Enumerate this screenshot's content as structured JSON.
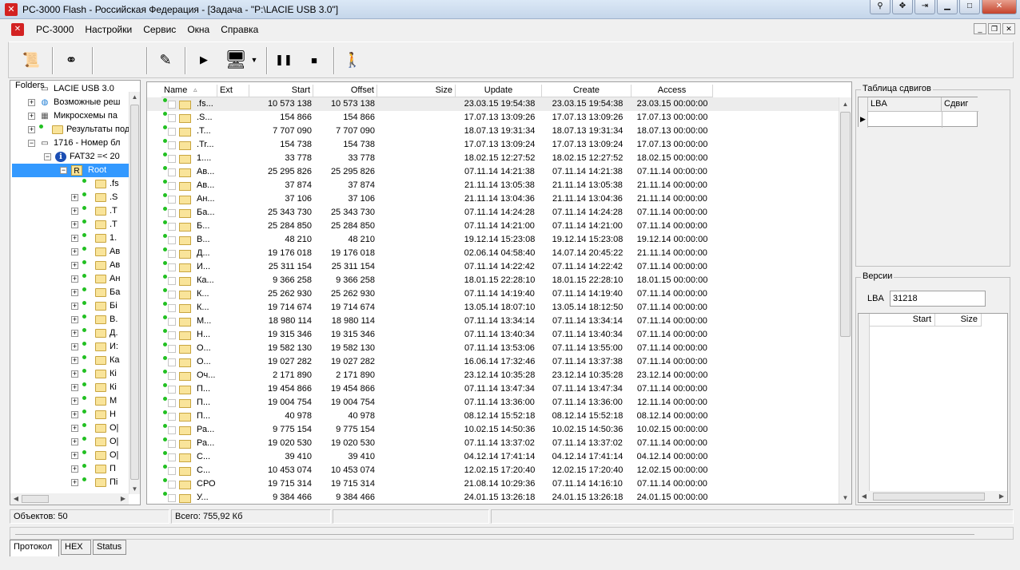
{
  "window": {
    "title": "PC-3000 Flash  - Российская Федерация - [Задача - \"P:\\LACIE USB 3.0\"]",
    "icon_text": "✕"
  },
  "menu": {
    "items": [
      "PC-3000",
      "Настройки",
      "Сервис",
      "Окна",
      "Справка"
    ]
  },
  "left_panel": {
    "title": "Folders",
    "tree": [
      {
        "label": "LACIE USB 3.0",
        "level": 1,
        "expand": "",
        "icon": "drive"
      },
      {
        "label": "Возможные реш",
        "level": 1,
        "expand": "+",
        "icon": "globe"
      },
      {
        "label": "Микросхемы па",
        "level": 1,
        "expand": "+",
        "icon": "chip"
      },
      {
        "label": "Результаты под",
        "level": 1,
        "expand": "+",
        "icon": "folder"
      },
      {
        "label": "1716 - Номер бл",
        "level": 1,
        "expand": "-",
        "icon": "drive"
      },
      {
        "label": "FAT32 =< 20",
        "level": 2,
        "expand": "-",
        "icon": "info"
      },
      {
        "label": "Root",
        "level": 3,
        "expand": "-",
        "icon": "root",
        "selected": true
      },
      {
        "label": ".fs",
        "level": 4,
        "expand": "",
        "icon": "folder"
      },
      {
        "label": ".S",
        "level": 4,
        "expand": "+",
        "icon": "folder"
      },
      {
        "label": ".T",
        "level": 4,
        "expand": "+",
        "icon": "folder"
      },
      {
        "label": ".T",
        "level": 4,
        "expand": "+",
        "icon": "folder"
      },
      {
        "label": "1.",
        "level": 4,
        "expand": "+",
        "icon": "folder"
      },
      {
        "label": "Ав",
        "level": 4,
        "expand": "+",
        "icon": "folder"
      },
      {
        "label": "Ав",
        "level": 4,
        "expand": "+",
        "icon": "folder"
      },
      {
        "label": "Ан",
        "level": 4,
        "expand": "+",
        "icon": "folder"
      },
      {
        "label": "Ба",
        "level": 4,
        "expand": "+",
        "icon": "folder"
      },
      {
        "label": "Бі",
        "level": 4,
        "expand": "+",
        "icon": "folder"
      },
      {
        "label": "В.",
        "level": 4,
        "expand": "+",
        "icon": "folder"
      },
      {
        "label": "Д.",
        "level": 4,
        "expand": "+",
        "icon": "folder"
      },
      {
        "label": "И:",
        "level": 4,
        "expand": "+",
        "icon": "folder"
      },
      {
        "label": "Ка",
        "level": 4,
        "expand": "+",
        "icon": "folder"
      },
      {
        "label": "Кі",
        "level": 4,
        "expand": "+",
        "icon": "folder"
      },
      {
        "label": "Кі",
        "level": 4,
        "expand": "+",
        "icon": "folder"
      },
      {
        "label": "М",
        "level": 4,
        "expand": "+",
        "icon": "folder"
      },
      {
        "label": "Н",
        "level": 4,
        "expand": "+",
        "icon": "folder"
      },
      {
        "label": "О|",
        "level": 4,
        "expand": "+",
        "icon": "folder"
      },
      {
        "label": "О|",
        "level": 4,
        "expand": "+",
        "icon": "folder"
      },
      {
        "label": "О|",
        "level": 4,
        "expand": "+",
        "icon": "folder"
      },
      {
        "label": "П",
        "level": 4,
        "expand": "+",
        "icon": "folder"
      },
      {
        "label": "Пі",
        "level": 4,
        "expand": "+",
        "icon": "folder"
      }
    ]
  },
  "grid": {
    "columns": [
      "Name",
      "Ext",
      "Start",
      "Offset",
      "Size",
      "Update",
      "Create",
      "Access"
    ],
    "rows": [
      [
        ".fs...",
        "",
        "10 573 138",
        "10 573 138",
        "",
        "23.03.15 19:54:38",
        "23.03.15 19:54:38",
        "23.03.15 00:00:00"
      ],
      [
        ".S...",
        "",
        "154 866",
        "154 866",
        "",
        "17.07.13 13:09:26",
        "17.07.13 13:09:26",
        "17.07.13 00:00:00"
      ],
      [
        ".T...",
        "",
        "7 707 090",
        "7 707 090",
        "",
        "18.07.13 19:31:34",
        "18.07.13 19:31:34",
        "18.07.13 00:00:00"
      ],
      [
        ".Tr...",
        "",
        "154 738",
        "154 738",
        "",
        "17.07.13 13:09:24",
        "17.07.13 13:09:24",
        "17.07.13 00:00:00"
      ],
      [
        "1....",
        "",
        "33 778",
        "33 778",
        "",
        "18.02.15 12:27:52",
        "18.02.15 12:27:52",
        "18.02.15 00:00:00"
      ],
      [
        "Ав...",
        "",
        "25 295 826",
        "25 295 826",
        "",
        "07.11.14 14:21:38",
        "07.11.14 14:21:38",
        "07.11.14 00:00:00"
      ],
      [
        "Ав...",
        "",
        "37 874",
        "37 874",
        "",
        "21.11.14 13:05:38",
        "21.11.14 13:05:38",
        "21.11.14 00:00:00"
      ],
      [
        "Ан...",
        "",
        "37 106",
        "37 106",
        "",
        "21.11.14 13:04:36",
        "21.11.14 13:04:36",
        "21.11.14 00:00:00"
      ],
      [
        "Ба...",
        "",
        "25 343 730",
        "25 343 730",
        "",
        "07.11.14 14:24:28",
        "07.11.14 14:24:28",
        "07.11.14 00:00:00"
      ],
      [
        "Б...",
        "",
        "25 284 850",
        "25 284 850",
        "",
        "07.11.14 14:21:00",
        "07.11.14 14:21:00",
        "07.11.14 00:00:00"
      ],
      [
        "В...",
        "",
        "48 210",
        "48 210",
        "",
        "19.12.14 15:23:08",
        "19.12.14 15:23:08",
        "19.12.14 00:00:00"
      ],
      [
        "Д...",
        "",
        "19 176 018",
        "19 176 018",
        "",
        "02.06.14 04:58:40",
        "14.07.14 20:45:22",
        "21.11.14 00:00:00"
      ],
      [
        "И...",
        "",
        "25 311 154",
        "25 311 154",
        "",
        "07.11.14 14:22:42",
        "07.11.14 14:22:42",
        "07.11.14 00:00:00"
      ],
      [
        "Ка...",
        "",
        "9 366 258",
        "9 366 258",
        "",
        "18.01.15 22:28:10",
        "18.01.15 22:28:10",
        "18.01.15 00:00:00"
      ],
      [
        "К...",
        "",
        "25 262 930",
        "25 262 930",
        "",
        "07.11.14 14:19:40",
        "07.11.14 14:19:40",
        "07.11.14 00:00:00"
      ],
      [
        "К...",
        "",
        "19 714 674",
        "19 714 674",
        "",
        "13.05.14 18:07:10",
        "13.05.14 18:12:50",
        "07.11.14 00:00:00"
      ],
      [
        "М...",
        "",
        "18 980 114",
        "18 980 114",
        "",
        "07.11.14 13:34:14",
        "07.11.14 13:34:14",
        "07.11.14 00:00:00"
      ],
      [
        "Н...",
        "",
        "19 315 346",
        "19 315 346",
        "",
        "07.11.14 13:40:34",
        "07.11.14 13:40:34",
        "07.11.14 00:00:00"
      ],
      [
        "О...",
        "",
        "19 582 130",
        "19 582 130",
        "",
        "07.11.14 13:53:06",
        "07.11.14 13:55:00",
        "07.11.14 00:00:00"
      ],
      [
        "О...",
        "",
        "19 027 282",
        "19 027 282",
        "",
        "16.06.14 17:32:46",
        "07.11.14 13:37:38",
        "07.11.14 00:00:00"
      ],
      [
        "Оч...",
        "",
        "2 171 890",
        "2 171 890",
        "",
        "23.12.14 10:35:28",
        "23.12.14 10:35:28",
        "23.12.14 00:00:00"
      ],
      [
        "П...",
        "",
        "19 454 866",
        "19 454 866",
        "",
        "07.11.14 13:47:34",
        "07.11.14 13:47:34",
        "07.11.14 00:00:00"
      ],
      [
        "П...",
        "",
        "19 004 754",
        "19 004 754",
        "",
        "07.11.14 13:36:00",
        "07.11.14 13:36:00",
        "12.11.14 00:00:00"
      ],
      [
        "П...",
        "",
        "40 978",
        "40 978",
        "",
        "08.12.14 15:52:18",
        "08.12.14 15:52:18",
        "08.12.14 00:00:00"
      ],
      [
        "Ра...",
        "",
        "9 775 154",
        "9 775 154",
        "",
        "10.02.15 14:50:36",
        "10.02.15 14:50:36",
        "10.02.15 00:00:00"
      ],
      [
        "Ра...",
        "",
        "19 020 530",
        "19 020 530",
        "",
        "07.11.14 13:37:02",
        "07.11.14 13:37:02",
        "07.11.14 00:00:00"
      ],
      [
        "С...",
        "",
        "39 410",
        "39 410",
        "",
        "04.12.14 17:41:14",
        "04.12.14 17:41:14",
        "04.12.14 00:00:00"
      ],
      [
        "С...",
        "",
        "10 453 074",
        "10 453 074",
        "",
        "12.02.15 17:20:40",
        "12.02.15 17:20:40",
        "12.02.15 00:00:00"
      ],
      [
        "СРО",
        "",
        "19 715 314",
        "19 715 314",
        "",
        "21.08.14 10:29:36",
        "07.11.14 14:16:10",
        "07.11.14 00:00:00"
      ],
      [
        "У...",
        "",
        "9 384 466",
        "9 384 466",
        "",
        "24.01.15 13:26:18",
        "24.01.15 13:26:18",
        "24.01.15 00:00:00"
      ]
    ]
  },
  "shift_table": {
    "title": "Таблица сдвигов",
    "columns": [
      "LBA",
      "Сдвиг"
    ]
  },
  "versions": {
    "title": "Версии",
    "lba_label": "LBA",
    "lba_value": "31218",
    "columns": [
      "Start",
      "Size"
    ]
  },
  "status": {
    "objects": "Объектов: 50",
    "total": "Всего: 755,92 Кб"
  },
  "bottom_tabs": [
    "Протокол",
    "HEX",
    "Status"
  ]
}
